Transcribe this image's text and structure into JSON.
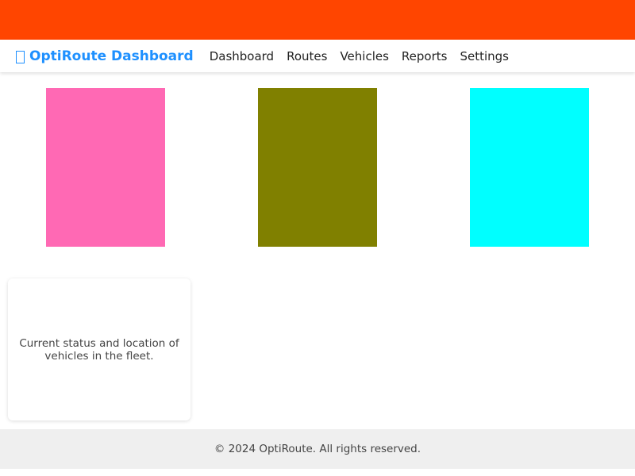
{
  "colors": {
    "banner": "#ff4500",
    "brand": "#1e90ff",
    "block_1": "#ff69b4",
    "block_2": "#808000",
    "block_3": "#00ffff"
  },
  "navbar": {
    "brand_icon": "box-icon",
    "brand_title": "OptiRoute Dashboard",
    "links": [
      "Dashboard",
      "Routes",
      "Vehicles",
      "Reports",
      "Settings"
    ]
  },
  "card": {
    "description": "Current status and location of vehicles in the fleet."
  },
  "footer": {
    "text": "© 2024 OptiRoute. All rights reserved."
  }
}
